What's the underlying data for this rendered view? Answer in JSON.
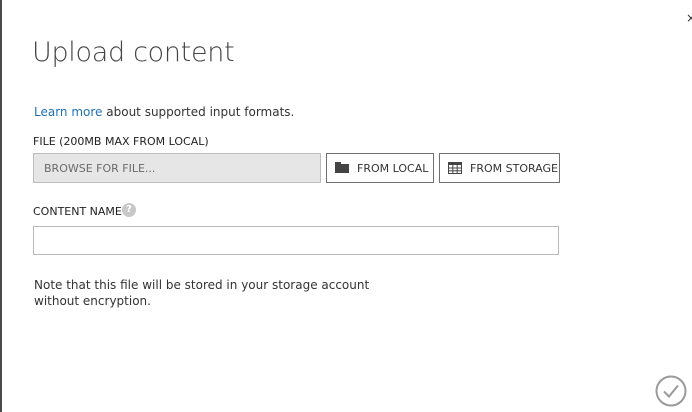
{
  "dialog": {
    "title": "Upload content",
    "close_glyph": "×",
    "info": {
      "link_text": "Learn more",
      "text": " about supported input formats."
    },
    "file": {
      "label": "FILE (200MB MAX FROM LOCAL)",
      "browse_placeholder": "BROWSE FOR FILE...",
      "from_local_label": "FROM LOCAL",
      "from_storage_label": "FROM STORAGE"
    },
    "content_name": {
      "label": "CONTENT NAME",
      "help_glyph": "?",
      "value": ""
    },
    "note": "Note that this file will be stored in your storage account without encryption."
  },
  "icons": {
    "folder": "folder-icon",
    "storage": "storage-grid-icon",
    "help": "help-icon",
    "ok": "checkmark-circle-icon",
    "close": "close-icon"
  },
  "colors": {
    "link": "#2072b8",
    "browse_bg": "#e6e6e6",
    "button_border": "#707070",
    "ok_circle": "#9a9a9a"
  }
}
